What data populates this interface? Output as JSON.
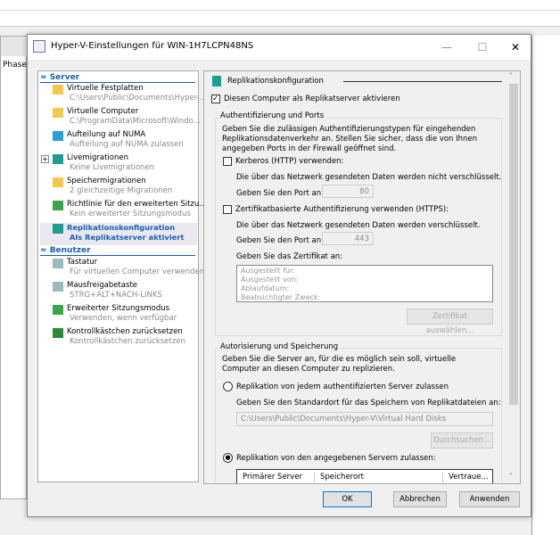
{
  "background": {
    "phase_label": "Phase"
  },
  "dialog": {
    "title": "Hyper-V-Einstellungen für WIN-1H7LCPN48NS",
    "minimize": "—",
    "maximize": "☐",
    "close": "✕"
  },
  "tree": {
    "server_header": "Server",
    "server_items": [
      {
        "label": "Virtuelle Festplatten",
        "sub": "C:\\Users\\Public\\Documents\\Hyper-...",
        "icon": "disk-icon",
        "color": "#f2c94c"
      },
      {
        "label": "Virtuelle Computer",
        "sub": "C:\\ProgramData\\Microsoft\\Windo...",
        "icon": "vm-folder-icon",
        "color": "#f2c94c"
      },
      {
        "label": "Aufteilung auf NUMA",
        "sub": "Aufteilung auf NUMA zulassen",
        "icon": "numa-icon",
        "color": "#2a9fd6"
      },
      {
        "label": "Livemigrationen",
        "sub": "Keine Livemigrationen",
        "icon": "live-migration-icon",
        "color": "#1e9e8f"
      },
      {
        "label": "Speichermigrationen",
        "sub": "2 gleichzeitige Migrationen",
        "icon": "storage-migration-icon",
        "color": "#f2c94c"
      },
      {
        "label": "Richtlinie für den erweiterten Sitzu...",
        "sub": "Kein erweiterter Sitzungsmodus",
        "icon": "session-policy-icon",
        "color": "#3aa54a"
      },
      {
        "label": "Replikationskonfiguration",
        "sub": "Als Replikatserver aktiviert",
        "icon": "replication-icon",
        "color": "#1e9e8f"
      }
    ],
    "user_header": "Benutzer",
    "user_items": [
      {
        "label": "Tastatur",
        "sub": "Für virtuellen Computer verwenden",
        "icon": "keyboard-icon",
        "color": "#9bb"
      },
      {
        "label": "Mausfreigabetaste",
        "sub": "STRG+ALT+NACH-LINKS",
        "icon": "mouse-release-icon",
        "color": "#9bb"
      },
      {
        "label": "Erweiterter Sitzungsmodus",
        "sub": "Verwenden, wenn verfügbar",
        "icon": "session-mode-icon",
        "color": "#3aa54a"
      },
      {
        "label": "Kontrollkästchen zurücksetzen",
        "sub": "Kontrollkästchen zurücksetzen",
        "icon": "reset-checkbox-icon",
        "color": "#2a8a3a"
      }
    ]
  },
  "pane": {
    "section_title": "Replikationskonfiguration",
    "enable_replica": {
      "label": "Diesen Computer als Replikatserver aktivieren",
      "checked": true
    },
    "auth": {
      "title": "Authentifizierung und Ports",
      "desc": "Geben Sie die zulässigen Authentifizierungstypen für eingehenden Replikationsdatenverkehr an. Stellen Sie sicher, dass die von Ihnen angegeben Ports in der Firewall geöffnet sind.",
      "kerberos_label": "Kerberos (HTTP) verwenden:",
      "kerberos_checked": false,
      "kerberos_note": "Die über das Netzwerk gesendeten Daten werden nicht verschlüsselt.",
      "port_label": "Geben Sie den Port an:",
      "kerberos_port": "80",
      "cert_label": "Zertifikatbasierte Authentifizierung verwenden (HTTPS):",
      "cert_checked": false,
      "cert_note": "Die über das Netzwerk gesendeten Daten werden verschlüsselt.",
      "cert_port": "443",
      "cert_specify": "Geben Sie das Zertifikat an:",
      "cert_fields": [
        "Ausgestellt für:",
        "Ausgestellt von:",
        "Ablaufdatum:",
        "Beabsichtigter Zweck:"
      ],
      "cert_button": "Zertifikat auswählen..."
    },
    "authz": {
      "title": "Autorisierung und Speicherung",
      "desc": "Geben Sie die Server an, für die es möglich sein soll, virtuelle Computer an diesen Computer zu replizieren.",
      "any_label": "Replikation von jedem authentifizierten Server zulassen",
      "default_loc_label": "Geben Sie den Standardort für das Speichern von Replikatdateien an:",
      "default_loc": "C:\\Users\\Public\\Documents\\Hyper-V\\Virtual Hard Disks",
      "browse": "Durchsuchen...",
      "specified_label": "Replikation von den angegebenen Servern zulassen:",
      "selected": "specified",
      "columns": [
        "Primärer Server",
        "Speicherort",
        "Vertraue..."
      ]
    }
  },
  "footer": {
    "ok": "OK",
    "cancel": "Abbrechen",
    "apply": "Anwenden"
  }
}
